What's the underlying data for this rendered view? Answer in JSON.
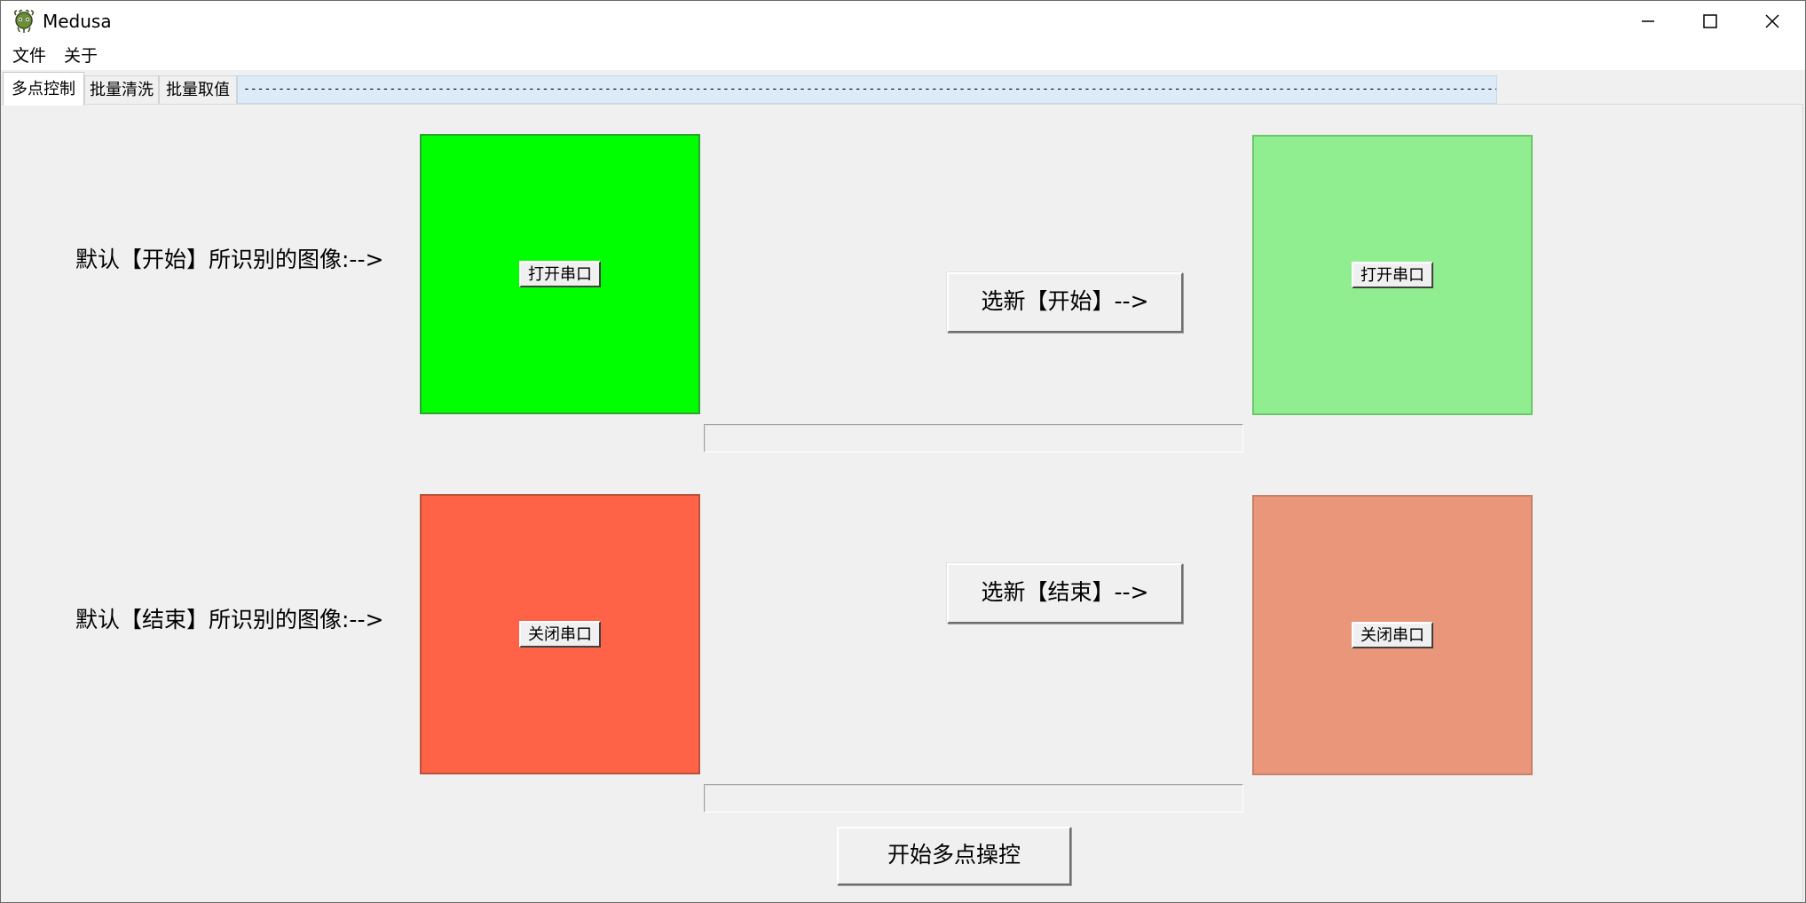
{
  "window": {
    "title": "Medusa",
    "icon": "medusa-app-icon",
    "controls": {
      "minimize_icon": "minimize-icon",
      "maximize_icon": "maximize-icon",
      "close_icon": "close-icon"
    }
  },
  "menubar": {
    "items": [
      {
        "label": "文件"
      },
      {
        "label": "关于"
      }
    ]
  },
  "tabs": {
    "items": [
      {
        "label": "多点控制",
        "active": true
      },
      {
        "label": "批量清洗",
        "active": false
      },
      {
        "label": "批量取值",
        "active": false
      }
    ],
    "filler_text": "-----------------------------------------------------------------------------------------------------------------------------------------------------------------------------------------------------------------------------------"
  },
  "start_section": {
    "label": "默认【开始】所识别的图像:-->",
    "default_box": {
      "color": "#00ff00",
      "button_label": "打开串口"
    },
    "select_button_label": "选新【开始】-->",
    "new_box": {
      "color": "#90ee90",
      "button_label": "打开串口"
    },
    "status_value": ""
  },
  "end_section": {
    "label": "默认【结束】所识别的图像:-->",
    "default_box": {
      "color": "#ff6347",
      "button_label": "关闭串口"
    },
    "select_button_label": "选新【结束】-->",
    "new_box": {
      "color": "#e9967a",
      "button_label": "关闭串口"
    },
    "status_value": ""
  },
  "main_action": {
    "label": "开始多点操控"
  }
}
